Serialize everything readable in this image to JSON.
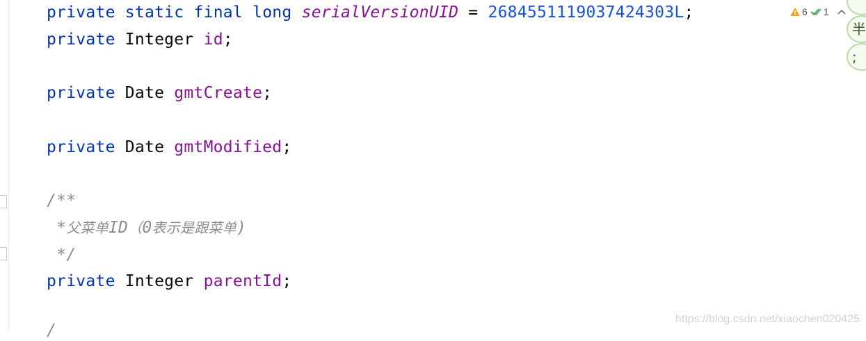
{
  "editor": {
    "lines": [
      {
        "tokens": [
          {
            "t": "private",
            "c": "kw"
          },
          {
            "t": " ",
            "c": "pun"
          },
          {
            "t": "static",
            "c": "kw"
          },
          {
            "t": " ",
            "c": "pun"
          },
          {
            "t": "final",
            "c": "kw"
          },
          {
            "t": " ",
            "c": "pun"
          },
          {
            "t": "long",
            "c": "kw"
          },
          {
            "t": " ",
            "c": "pun"
          },
          {
            "t": "serialVersionUID",
            "c": "fld-static"
          },
          {
            "t": " = ",
            "c": "pun"
          },
          {
            "t": "2684551119037424303L",
            "c": "num"
          },
          {
            "t": ";",
            "c": "pun"
          }
        ]
      },
      {
        "tokens": [
          {
            "t": "private",
            "c": "kw"
          },
          {
            "t": " ",
            "c": "pun"
          },
          {
            "t": "Integer",
            "c": "ty"
          },
          {
            "t": " ",
            "c": "pun"
          },
          {
            "t": "id",
            "c": "fld"
          },
          {
            "t": ";",
            "c": "pun"
          }
        ]
      },
      {
        "tokens": [
          {
            "t": "private",
            "c": "kw"
          },
          {
            "t": " ",
            "c": "pun"
          },
          {
            "t": "Date",
            "c": "ty"
          },
          {
            "t": " ",
            "c": "pun"
          },
          {
            "t": "gmtCreate",
            "c": "fld"
          },
          {
            "t": ";",
            "c": "pun"
          }
        ]
      },
      {
        "tokens": [
          {
            "t": "private",
            "c": "kw"
          },
          {
            "t": " ",
            "c": "pun"
          },
          {
            "t": "Date",
            "c": "ty"
          },
          {
            "t": " ",
            "c": "pun"
          },
          {
            "t": "gmtModified",
            "c": "fld"
          },
          {
            "t": ";",
            "c": "pun"
          }
        ]
      },
      {
        "tokens": [
          {
            "t": "/**",
            "c": "cmt"
          }
        ]
      },
      {
        "tokens": [
          {
            "t": " *",
            "c": "cmt"
          },
          {
            "t": "父菜单",
            "c": "cmt cmt-cjk"
          },
          {
            "t": "ID",
            "c": "cmt"
          },
          {
            "t": "（",
            "c": "cmt cmt-cjk"
          },
          {
            "t": "0",
            "c": "cmt"
          },
          {
            "t": "表示是跟菜单",
            "c": "cmt cmt-cjk"
          },
          {
            "t": ")",
            "c": "cmt"
          }
        ]
      },
      {
        "tokens": [
          {
            "t": " */",
            "c": "cmt"
          }
        ]
      },
      {
        "tokens": [
          {
            "t": "private",
            "c": "kw"
          },
          {
            "t": " ",
            "c": "pun"
          },
          {
            "t": "Integer",
            "c": "ty"
          },
          {
            "t": " ",
            "c": "pun"
          },
          {
            "t": "parentId",
            "c": "fld"
          },
          {
            "t": ";",
            "c": "pun"
          }
        ]
      },
      {
        "tokens": [
          {
            "t": "/",
            "c": "cmt"
          }
        ]
      }
    ]
  },
  "inspections": {
    "warnings_count": "6",
    "typos_count": "1",
    "warning_icon": "warning-triangle-icon",
    "typo_icon": "double-check-icon",
    "nav_icon": "chevron-up-icon"
  },
  "side_decorations": [
    "",
    "半",
    ";"
  ],
  "watermark": "https://blog.csdn.net/xiaochen020425",
  "colors": {
    "keyword": "#0033b3",
    "field": "#871094",
    "number": "#1750eb",
    "comment": "#8c8c8c",
    "warning": "#f0a30a",
    "check": "#59a869"
  }
}
